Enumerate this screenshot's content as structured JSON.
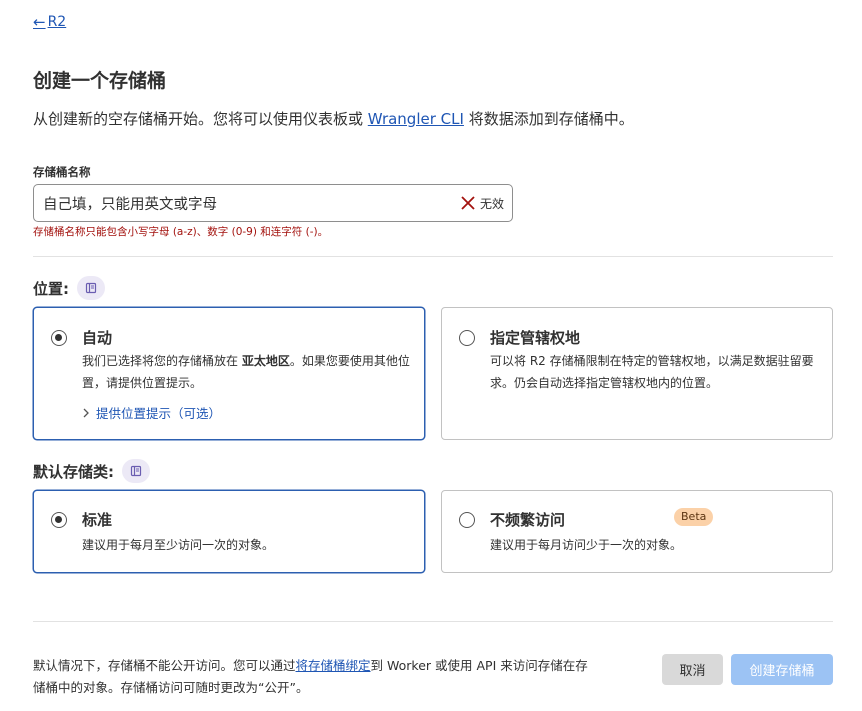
{
  "nav": {
    "back_arrow": "←",
    "back_label": "R2"
  },
  "page": {
    "title": "创建一个存储桶",
    "desc_before": "从创建新的空存储桶开始。您将可以使用仪表板或 ",
    "desc_link": "Wrangler CLI",
    "desc_after": " 将数据添加到存储桶中。"
  },
  "bucket_name": {
    "label": "存储桶名称",
    "value": "自己填，只能用英文或字母",
    "status_icon": "x-icon",
    "status": "无效",
    "error": "存储桶名称只能包含小写字母 (a-z)、数字 (0-9) 和连字符 (-)。",
    "colors": {
      "error": "#a3120e"
    }
  },
  "location": {
    "label": "位置:",
    "doc_icon": "book-icon",
    "options": [
      {
        "title": "自动",
        "selected": true,
        "body_before": "我们已选择将您的存储桶放在 ",
        "body_bold": "亚太地区",
        "body_after": "。如果您要使用其他位置，请提供位置提示。",
        "hint_link": "提供位置提示（可选）"
      },
      {
        "title": "指定管辖权地",
        "selected": false,
        "body": "可以将 R2 存储桶限制在特定的管辖权地，以满足数据驻留要求。仍会自动选择指定管辖权地内的位置。"
      }
    ]
  },
  "storage_class": {
    "label": "默认存储类:",
    "doc_icon": "book-icon",
    "options": [
      {
        "title": "标准",
        "selected": true,
        "body": "建议用于每月至少访问一次的对象。"
      },
      {
        "title": "不频繁访问",
        "selected": false,
        "badge": "Beta",
        "body": "建议用于每月访问少于一次的对象。"
      }
    ]
  },
  "footer": {
    "text_before": "默认情况下，存储桶不能公开访问。您可以通过",
    "text_link": "将存储桶绑定",
    "text_after": "到 Worker 或使用 API 来访问存储在存储桶中的对象。存储桶访问可随时更改为“公开”。",
    "cancel_label": "取消",
    "create_label": "创建存储桶"
  },
  "colors": {
    "accent": "#1f56b4",
    "selected_border": "#2c5fb0",
    "create_button": "#9cc3f4",
    "beta_badge": "#fbd1a8"
  }
}
